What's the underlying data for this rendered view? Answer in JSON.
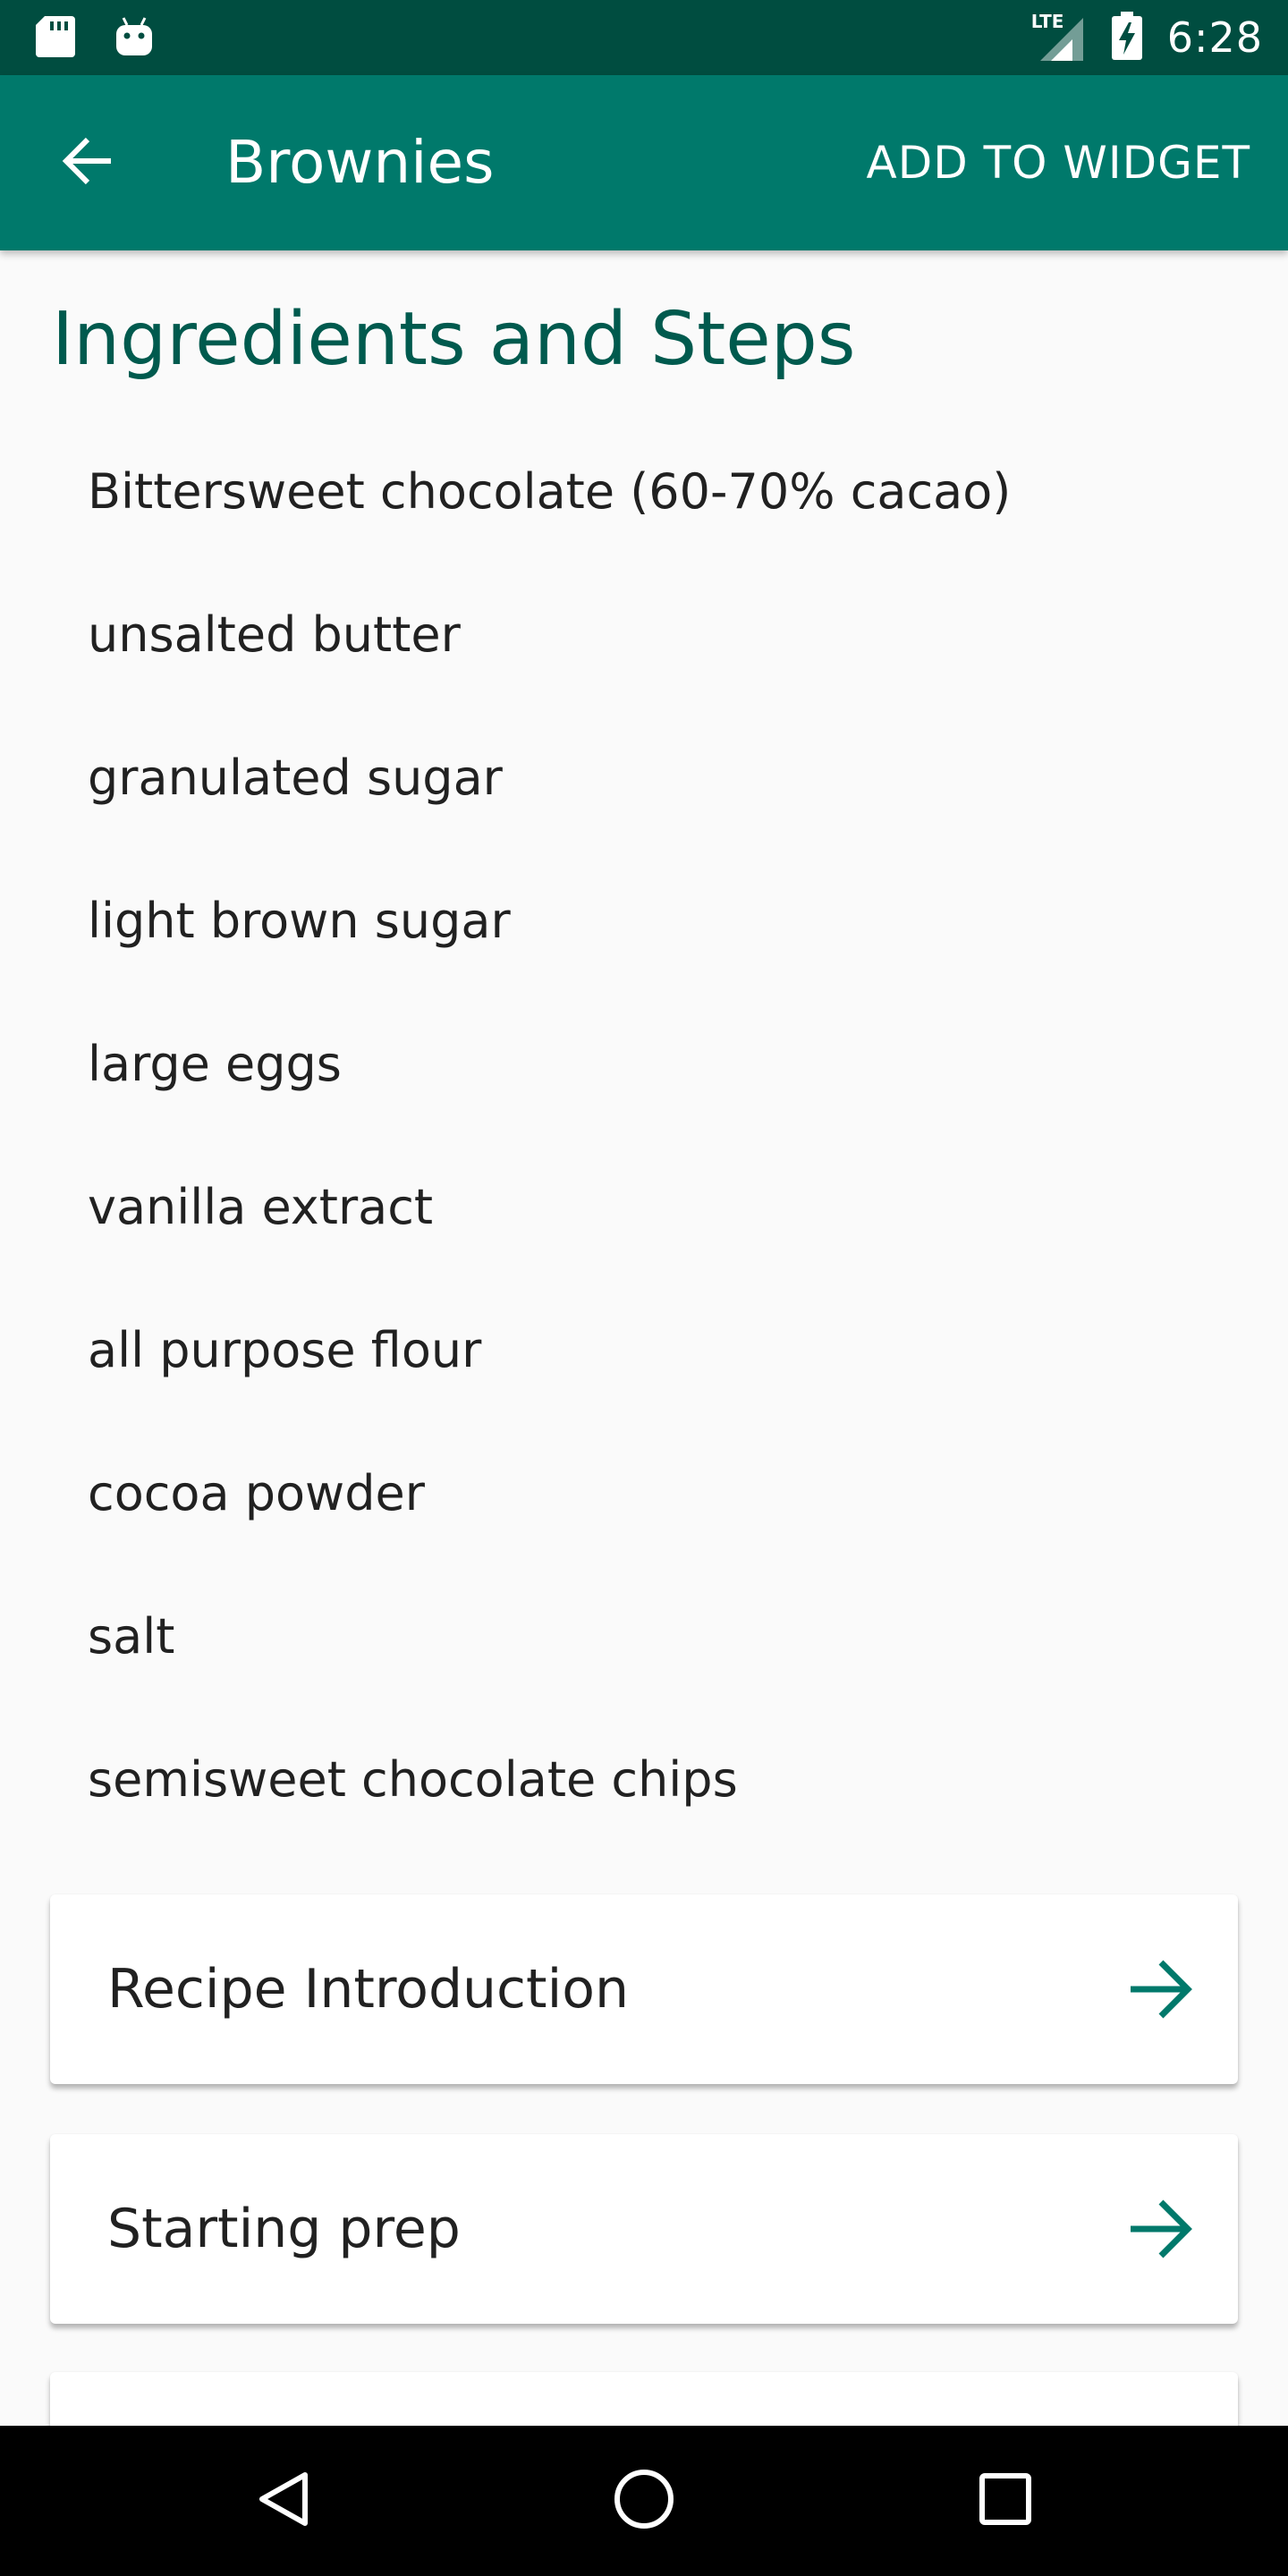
{
  "status_bar": {
    "time": "6:28",
    "network": "LTE",
    "icons": [
      "sd-card-icon",
      "android-icon",
      "lte-signal-icon",
      "battery-charging-icon"
    ]
  },
  "app_bar": {
    "title": "Brownies",
    "action_label": "ADD TO WIDGET",
    "back_icon": "arrow-back-icon"
  },
  "main": {
    "section_title": "Ingredients and Steps",
    "ingredients": [
      "Bittersweet chocolate (60-70% cacao)",
      "unsalted butter",
      "granulated sugar",
      "light brown sugar",
      "large eggs",
      "vanilla extract",
      "all purpose flour",
      "cocoa powder",
      "salt",
      "semisweet chocolate chips"
    ],
    "steps": [
      {
        "label": "Recipe Introduction",
        "icon": "arrow-forward-icon"
      },
      {
        "label": "Starting prep",
        "icon": "arrow-forward-icon"
      },
      {
        "label": "",
        "icon": ""
      }
    ]
  },
  "nav_bar": {
    "icons": [
      "back-triangle-icon",
      "home-circle-icon",
      "recents-square-icon"
    ]
  },
  "colors": {
    "status_bar": "#004d40",
    "app_bar": "#00796b",
    "accent": "#00796b",
    "section_title": "#005a4e",
    "background": "#fafafa",
    "text": "#212121"
  }
}
